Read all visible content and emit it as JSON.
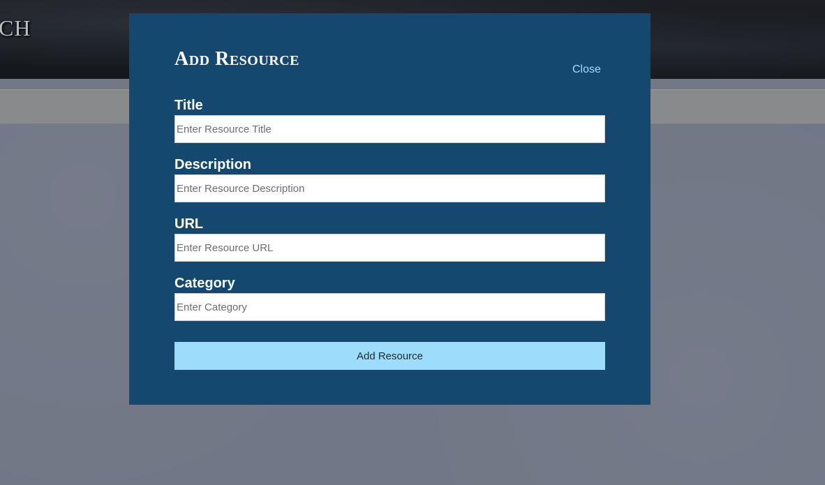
{
  "site": {
    "title_fragment": "CH"
  },
  "modal": {
    "title": "Add Resource",
    "close_label": "Close",
    "fields": [
      {
        "label": "Title",
        "placeholder": "Enter Resource Title",
        "value": ""
      },
      {
        "label": "Description",
        "placeholder": "Enter Resource Description",
        "value": ""
      },
      {
        "label": "URL",
        "placeholder": "Enter Resource URL",
        "value": ""
      },
      {
        "label": "Category",
        "placeholder": "Enter Category",
        "value": ""
      }
    ],
    "submit_label": "Add Resource"
  },
  "colors": {
    "modal_background": "#14486e",
    "submit_button": "#9edcfc",
    "close_link": "#a9dbfb",
    "page_background": "#808593",
    "nav_bar": "#9a9a9a",
    "header": "#15171a"
  }
}
